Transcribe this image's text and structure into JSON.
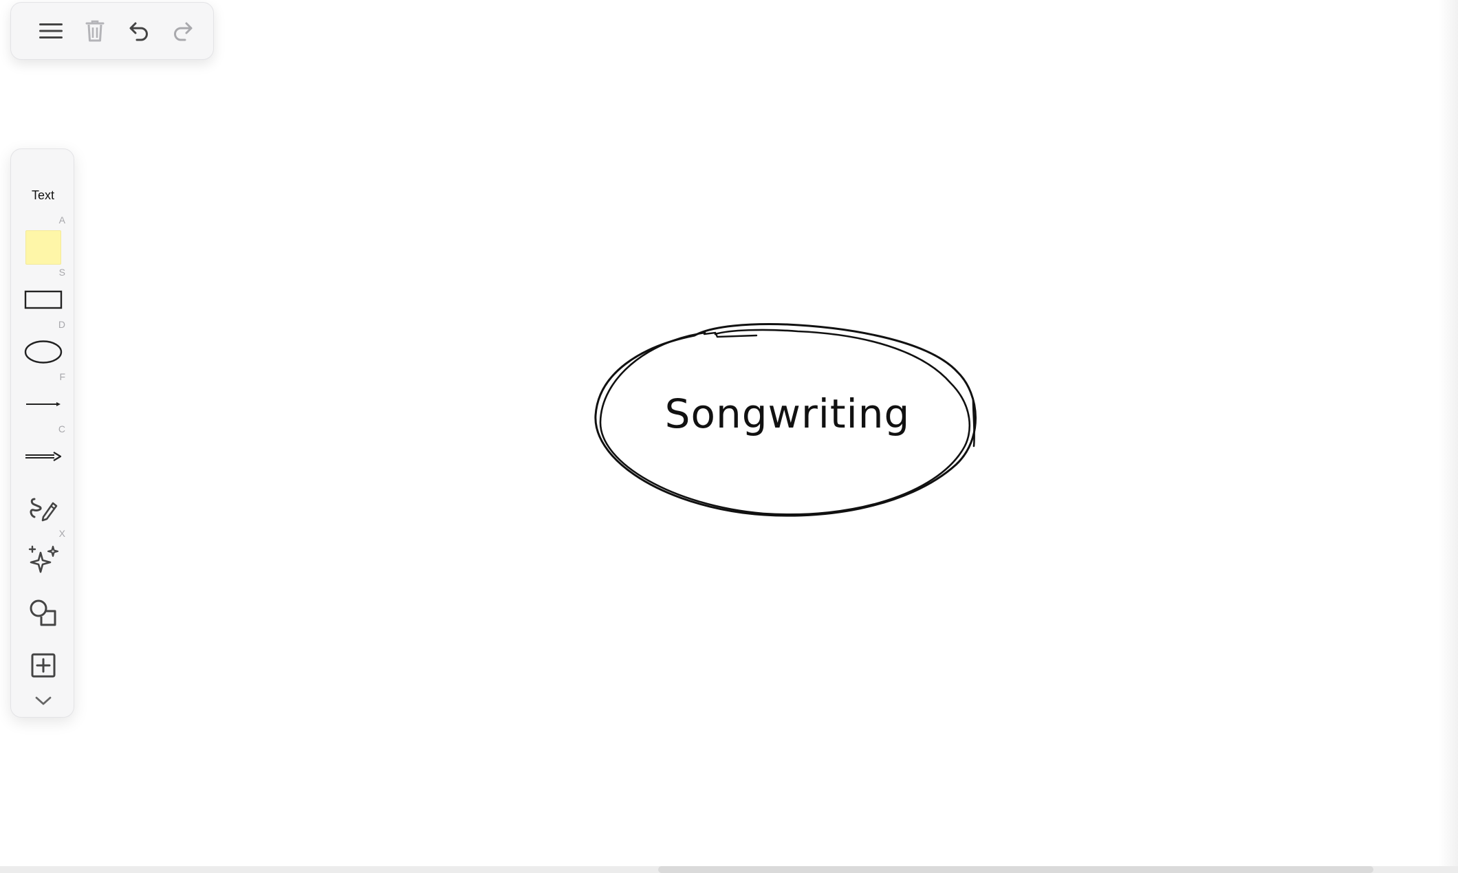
{
  "toolbar": {
    "menu_icon": "hamburger-menu-icon",
    "delete_icon": "trash-icon",
    "undo_icon": "undo-icon",
    "redo_icon": "redo-icon"
  },
  "palette": {
    "text_tool": {
      "label": "Text",
      "shortcut": "A"
    },
    "sticky_tool": {
      "icon": "sticky-note-icon",
      "shortcut": "S",
      "color": "#fef6a8"
    },
    "rectangle_tool": {
      "icon": "rectangle-icon",
      "shortcut": "D"
    },
    "ellipse_tool": {
      "icon": "ellipse-icon",
      "shortcut": "F"
    },
    "line_tool": {
      "icon": "line-icon",
      "shortcut": "C"
    },
    "arrow_tool": {
      "icon": "arrow-icon",
      "shortcut": ""
    },
    "draw_tool": {
      "icon": "pencil-draw-icon",
      "shortcut": "X"
    },
    "ai_tool": {
      "icon": "sparkles-icon"
    },
    "shapes_tool": {
      "icon": "shapes-icon"
    },
    "insert_tool": {
      "icon": "plus-square-icon"
    },
    "more_tool": {
      "icon": "chevron-down-icon"
    }
  },
  "canvas": {
    "node_text": "Songwriting"
  }
}
